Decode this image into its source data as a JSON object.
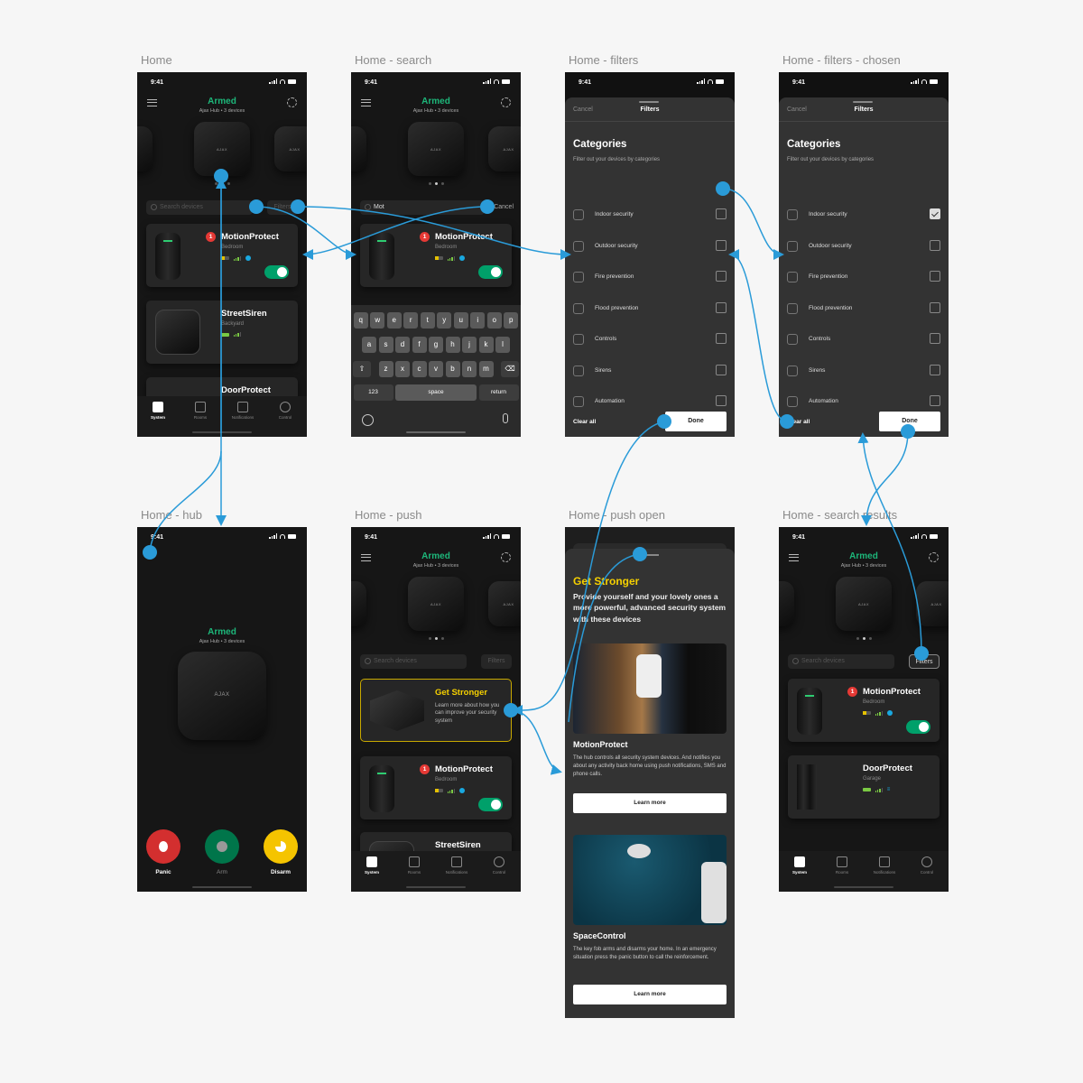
{
  "status_bar": {
    "time": "9:41"
  },
  "hub_header": {
    "status": "Armed",
    "subtitle": "Ajax Hub • 3 devices",
    "hub_logo": "AJAX"
  },
  "colors": {
    "armed": "#1db77a",
    "flow": "#2a9bd8",
    "promo": "#f5d000",
    "toggle_on": "#00a06a",
    "badge": "#e53935"
  },
  "search": {
    "placeholder": "Search devices",
    "typed_value": "Mot",
    "cancel": "Cancel",
    "filters": "Filters"
  },
  "tabs": [
    {
      "label": "System",
      "icon": "hub-icon",
      "active": true
    },
    {
      "label": "Rooms",
      "icon": "rooms-icon"
    },
    {
      "label": "Notifications",
      "icon": "notifications-icon"
    },
    {
      "label": "Control",
      "icon": "control-icon"
    }
  ],
  "devices": {
    "motion": {
      "name": "MotionProtect",
      "room": "Bedroom",
      "badge": "1",
      "enabled": true
    },
    "siren": {
      "name": "StreetSiren",
      "room": "Backyard"
    },
    "door": {
      "name": "DoorProtect",
      "room": "Garage"
    }
  },
  "screens": [
    {
      "title": "Home"
    },
    {
      "title": "Home - search"
    },
    {
      "title": "Home - filters"
    },
    {
      "title": "Home - filters - chosen"
    },
    {
      "title": "Home - hub"
    },
    {
      "title": "Home - push"
    },
    {
      "title": "Home - push open"
    },
    {
      "title": "Home - search results"
    }
  ],
  "keyboard": {
    "row1": [
      "q",
      "w",
      "e",
      "r",
      "t",
      "y",
      "u",
      "i",
      "o",
      "p"
    ],
    "row2": [
      "a",
      "s",
      "d",
      "f",
      "g",
      "h",
      "j",
      "k",
      "l"
    ],
    "row3": [
      "z",
      "x",
      "c",
      "v",
      "b",
      "n",
      "m"
    ],
    "numbers": "123",
    "space": "space",
    "return": "return"
  },
  "filters": {
    "cancel": "Cancel",
    "title": "Filters",
    "heading": "Categories",
    "subtitle": "Filter out your devices by categories",
    "categories": [
      {
        "label": "Indoor security",
        "icon": "house-icon"
      },
      {
        "label": "Outdoor security",
        "icon": "tree-house-icon"
      },
      {
        "label": "Fire prevention",
        "icon": "flame-icon"
      },
      {
        "label": "Flood prevention",
        "icon": "drop-icon"
      },
      {
        "label": "Controls",
        "icon": "keyfob-icon"
      },
      {
        "label": "Sirens",
        "icon": "siren-icon"
      },
      {
        "label": "Automation",
        "icon": "socket-icon"
      }
    ],
    "chosen": [
      "Indoor security"
    ],
    "clear_all": "Clear all",
    "done": "Done"
  },
  "hub_controls": {
    "panic": "Panic",
    "arm": "Arm",
    "disarm": "Disarm"
  },
  "promo": {
    "title": "Get Stronger",
    "body": "Learn more about how you can improve your security system"
  },
  "push_open": {
    "title": "Get Stronger",
    "body": "Provide yourself and your lovely ones a more powerful, advanced security system with these devices",
    "products": [
      {
        "name": "MotionProtect",
        "desc": "The hub controls all security system devices. And notifies you about any activity back home using push notifications, SMS and phone calls.",
        "cta": "Learn more"
      },
      {
        "name": "SpaceControl",
        "desc": "The key fob arms and disarms your home. In an emergency situation press the panic button to call the reinforcement.",
        "cta": "Learn more"
      }
    ]
  }
}
